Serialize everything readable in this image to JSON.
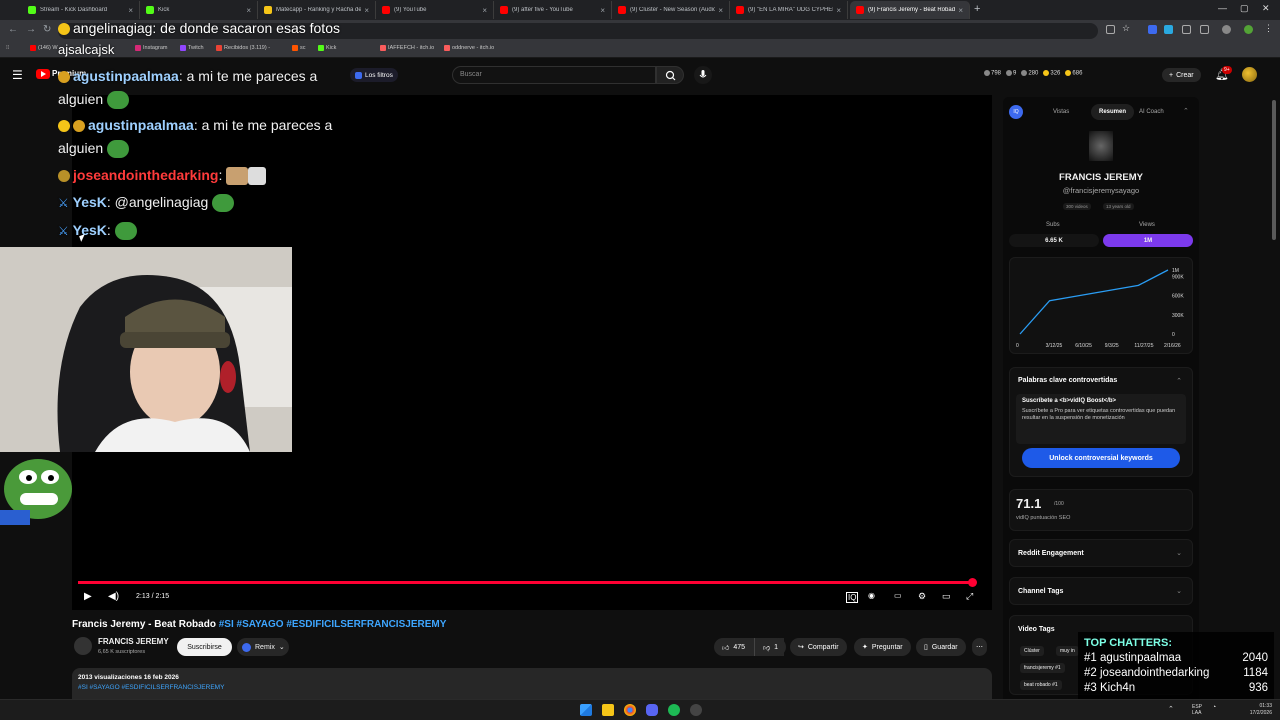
{
  "browser": {
    "tabs": [
      {
        "title": "Stream - Kick Dashboard",
        "color": "#53fc18"
      },
      {
        "title": "Kick",
        "color": "#53fc18"
      },
      {
        "title": "Matecapp - Ranking y Racha de",
        "color": "#f5c518"
      },
      {
        "title": "(9) YouTube",
        "color": "#ff0000"
      },
      {
        "title": "(9) after five - YouTube",
        "color": "#ff0000"
      },
      {
        "title": "(9) Cluster - New Season (Audio",
        "color": "#ff0000"
      },
      {
        "title": "(9) \"EN LA MIRA\" UDG CYPHER",
        "color": "#ff0000"
      },
      {
        "title": "(9) Francis Jeremy - Beat Robado",
        "color": "#ff0000"
      }
    ],
    "new_tab": "+",
    "bookmarks": [
      {
        "label": "(146) W",
        "color": "#ff0000"
      },
      {
        "label": "Instagram",
        "color": "#d62976"
      },
      {
        "label": "Twitch",
        "color": "#9146ff"
      },
      {
        "label": "Recibidos (3.119) -",
        "color": "#ea4335"
      },
      {
        "label": "sc",
        "color": "#ff5500"
      },
      {
        "label": "Kick",
        "color": "#53fc18"
      },
      {
        "label": "IAFFEFCH - itch.io",
        "color": "#fa5c5c"
      },
      {
        "label": "oddnerve - itch.io",
        "color": "#fa5c5c"
      }
    ]
  },
  "youtube": {
    "menu_icon": "☰",
    "premium": "Premium",
    "filters": "Los filtros",
    "search_placeholder": "Buscar",
    "header_stats": [
      "798",
      "9",
      "280",
      "326",
      "686"
    ],
    "create": "Crear",
    "notif_badge": "9+",
    "video_time": "2:13 / 2:15",
    "progress_fraction": 0.985,
    "title_main": "Francis Jeremy - Beat Robado ",
    "title_tags": "#SI #SAYAGO #ESDIFICILSERFRANCISJEREMY",
    "channel": "FRANCIS JEREMY",
    "subs": "6,65 K suscriptores",
    "subscribe": "Suscribirse",
    "remix": "Remix",
    "likes": "475",
    "dislikes": "1",
    "share": "Compartir",
    "ask": "Preguntar",
    "save": "Guardar",
    "views_line": "2013 visualizaciones  16 feb 2026",
    "desc_tags": "#SI #SAYAGO #ESDIFICILSERFRANCISJEREMY"
  },
  "chat": {
    "top_banner": "angelinagiag: de donde sacaron esas fotos",
    "top_user2": "ajsalcajsk",
    "lines": [
      {
        "user": "agustinpaalmaa",
        "msg": ": a mi te me pareces a",
        "cont": "alguien",
        "color": "#9ed0ff"
      },
      {
        "user": "agustinpaalmaa",
        "msg": ": a mi te me pareces a",
        "cont": "alguien",
        "color": "#9ed0ff"
      },
      {
        "user": "joseandointhedarking",
        "msg": ":",
        "cont": "",
        "color": "#ff3b3b"
      },
      {
        "user": "YesK",
        "msg": ": @angelinagiag",
        "cont": "",
        "color": "#9ed0ff"
      },
      {
        "user": "YesK",
        "msg": ":",
        "cont": "",
        "color": "#9ed0ff"
      }
    ]
  },
  "vidiq": {
    "tabs": [
      "Vistas",
      "Resumen",
      "AI Coach"
    ],
    "channel_name": "FRANCIS JEREMY",
    "handle": "@francisjeremysayago",
    "meta": [
      "300 videos",
      "13 years old"
    ],
    "subs_label": "Subs",
    "views_label": "Views",
    "subs_value": "6.65 K",
    "views_value": "1M",
    "chart_y_ticks": [
      "1M",
      "900K",
      "600K",
      "300K",
      "0"
    ],
    "chart_x_ticks": [
      "0",
      "3/12/25",
      "6/10/25",
      "9/3/25",
      "11/27/25",
      "2/16/26"
    ],
    "controversial_title": "Palabras clave controvertidas",
    "boost_title": "Suscríbete a <b>vidIQ Boost</b>",
    "boost_text": "Suscríbete a Pro para ver etiquetas controvertidas que puedan resultar en la suspensión de monetización",
    "unlock": "Unlock controversial keywords",
    "score": "71.1",
    "score_of": "/100",
    "score_label": "vidIQ puntuación SEO",
    "reddit": "Reddit Engagement",
    "channel_tags": "Channel Tags",
    "video_tags": "Video Tags",
    "tags": [
      "Clúster",
      "muy in",
      "francis",
      "jeremy",
      "francisjeremy #1",
      "beat robado #1"
    ]
  },
  "top_chatters": {
    "title": "TOP CHATTERS:",
    "rows": [
      {
        "rank": "#1",
        "name": "agustinpaalmaa",
        "count": "2040"
      },
      {
        "rank": "#2",
        "name": "joseandointhedarking",
        "count": "1184"
      },
      {
        "rank": "#3",
        "name": "Kich4n",
        "count": "936"
      }
    ]
  },
  "taskbar": {
    "lang": "ESP\nLAA",
    "time": "01:33",
    "date": "17/2/2026"
  },
  "chart_data": {
    "type": "line",
    "x": [
      "0",
      "3/12/25",
      "6/10/25",
      "9/3/25",
      "11/27/25",
      "2/16/26"
    ],
    "y_ticks": [
      "0",
      "300K",
      "600K",
      "900K",
      "1M"
    ],
    "series": [
      {
        "values": [
          0,
          520000,
          600000,
          680000,
          760000,
          1000000
        ]
      }
    ]
  }
}
